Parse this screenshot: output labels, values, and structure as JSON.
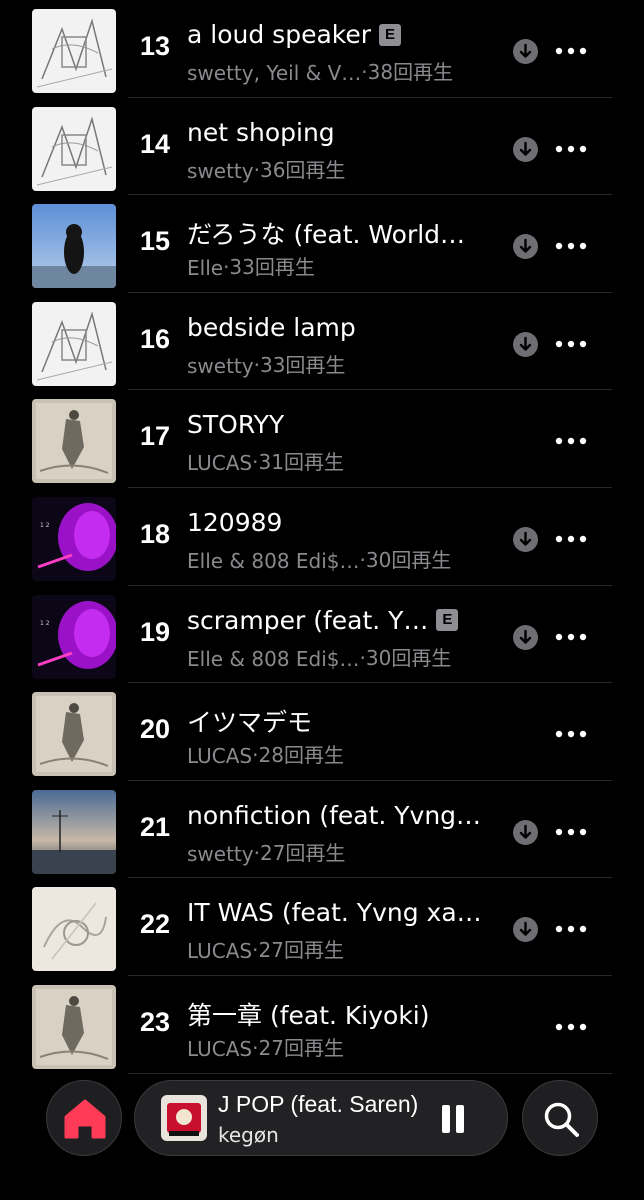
{
  "tracks": [
    {
      "rank": "13",
      "title": "a loud speaker",
      "explicit": true,
      "artist": "swetty, Yeil & V…",
      "plays": "38回再生",
      "downloaded": true,
      "art": "sketch"
    },
    {
      "rank": "14",
      "title": "net shoping",
      "explicit": false,
      "artist": "swetty",
      "plays": "36回再生",
      "downloaded": true,
      "art": "sketch"
    },
    {
      "rank": "15",
      "title": "だろうな (feat. World…",
      "explicit": false,
      "artist": "Elle",
      "plays": "33回再生",
      "downloaded": true,
      "art": "blue-sky"
    },
    {
      "rank": "16",
      "title": "bedside lamp",
      "explicit": false,
      "artist": "swetty",
      "plays": "33回再生",
      "downloaded": true,
      "art": "sketch"
    },
    {
      "rank": "17",
      "title": "STORYY",
      "explicit": false,
      "artist": "LUCAS",
      "plays": "31回再生",
      "downloaded": false,
      "art": "beige"
    },
    {
      "rank": "18",
      "title": "120989",
      "explicit": false,
      "artist": "Elle & 808 Edi$…",
      "plays": "30回再生",
      "downloaded": true,
      "art": "purple"
    },
    {
      "rank": "19",
      "title": "scramper (feat. Y…",
      "explicit": true,
      "artist": "Elle & 808 Edi$…",
      "plays": "30回再生",
      "downloaded": true,
      "art": "purple"
    },
    {
      "rank": "20",
      "title": "イツマデモ",
      "explicit": false,
      "artist": "LUCAS",
      "plays": "28回再生",
      "downloaded": false,
      "art": "beige"
    },
    {
      "rank": "21",
      "title": "nonfiction (feat. Yvng…",
      "explicit": false,
      "artist": "swetty",
      "plays": "27回再生",
      "downloaded": true,
      "art": "dusk"
    },
    {
      "rank": "22",
      "title": "IT WAS (feat. Yvng xa…",
      "explicit": false,
      "artist": "LUCAS",
      "plays": "27回再生",
      "downloaded": true,
      "art": "light"
    },
    {
      "rank": "23",
      "title": "第一章 (feat. Kiyoki)",
      "explicit": false,
      "artist": "LUCAS",
      "plays": "27回再生",
      "downloaded": false,
      "art": "beige"
    }
  ],
  "explicit_badge": "E",
  "separator": "·",
  "now_playing": {
    "title": "J POP (feat. Saren)",
    "artist": "kegøn"
  },
  "colors": {
    "accent": "#ff3b57",
    "secondary_text": "#8a8a8e",
    "background": "#000000"
  },
  "icons": [
    "download-icon",
    "more-icon",
    "home-icon",
    "pause-icon",
    "search-icon",
    "explicit-badge"
  ]
}
